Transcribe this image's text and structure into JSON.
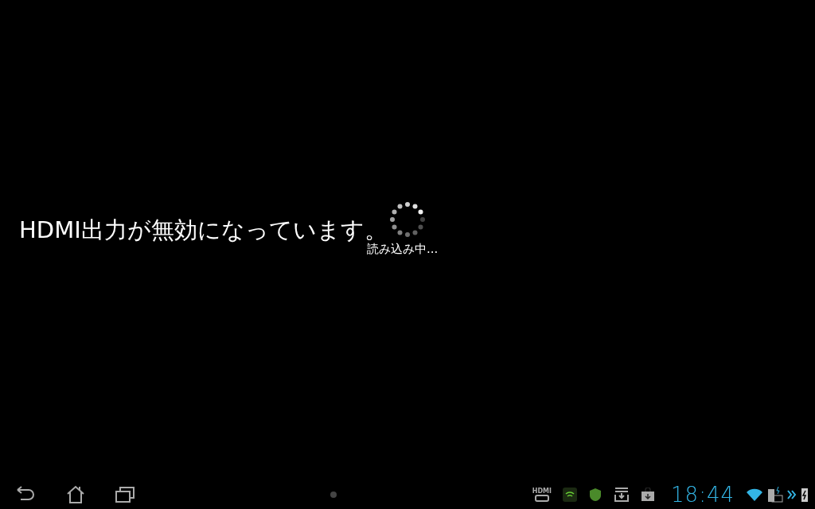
{
  "message": "HDMI出力が無効になっています。",
  "loading": {
    "text": "読み込み中..."
  },
  "system_bar": {
    "hdmi_label": "HDMI",
    "time": "18:44"
  }
}
